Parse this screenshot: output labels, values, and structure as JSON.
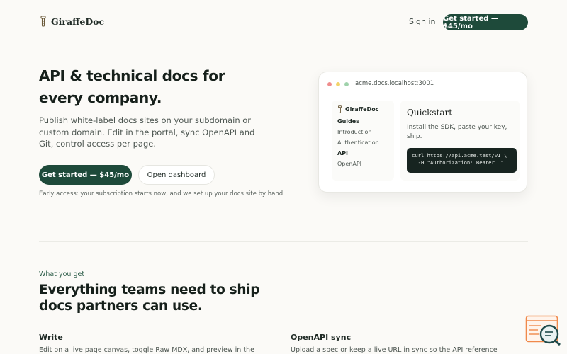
{
  "header": {
    "brand": "GiraffeDoc",
    "signin_label": "Sign in",
    "cta_label": "Get started — $45/mo"
  },
  "hero": {
    "title": "API & technical docs for every company.",
    "subtitle": "Publish white-label docs sites on your subdomain or custom domain. Edit in the portal, sync OpenAPI and Git, control access per page.",
    "primary_label": "Get started — $45/mo",
    "secondary_label": "Open dashboard",
    "note": "Early access: your subscription starts now, and we set up your docs site by hand."
  },
  "preview": {
    "url": "acme.docs.localhost:3001",
    "brand": "GiraffeDoc",
    "nav": [
      {
        "label": "Guides",
        "bold": true
      },
      {
        "label": "Introduction",
        "bold": false
      },
      {
        "label": "Authentication",
        "bold": false
      },
      {
        "label": "API",
        "bold": true
      },
      {
        "label": "OpenAPI",
        "bold": false
      }
    ],
    "title": "Quickstart",
    "description": "Install the SDK, paste your key, ship.",
    "code_line1": "curl https://api.acme.test/v1 \\",
    "code_line2": "  -H \"Authorization: Bearer …\""
  },
  "features": {
    "eyebrow": "What you get",
    "title": "Everything teams need to ship docs partners can use.",
    "items": [
      {
        "title": "Write",
        "description": "Edit on a live page canvas, toggle Raw MDX, and preview in the"
      },
      {
        "title": "OpenAPI sync",
        "description": "Upload a spec or keep a live URL in sync so the API reference"
      }
    ]
  },
  "colors": {
    "accent": "#1e4a3a",
    "background": "#fbfaf7",
    "widget_orange": "#f0894b",
    "widget_teal": "#1f4a4a"
  }
}
